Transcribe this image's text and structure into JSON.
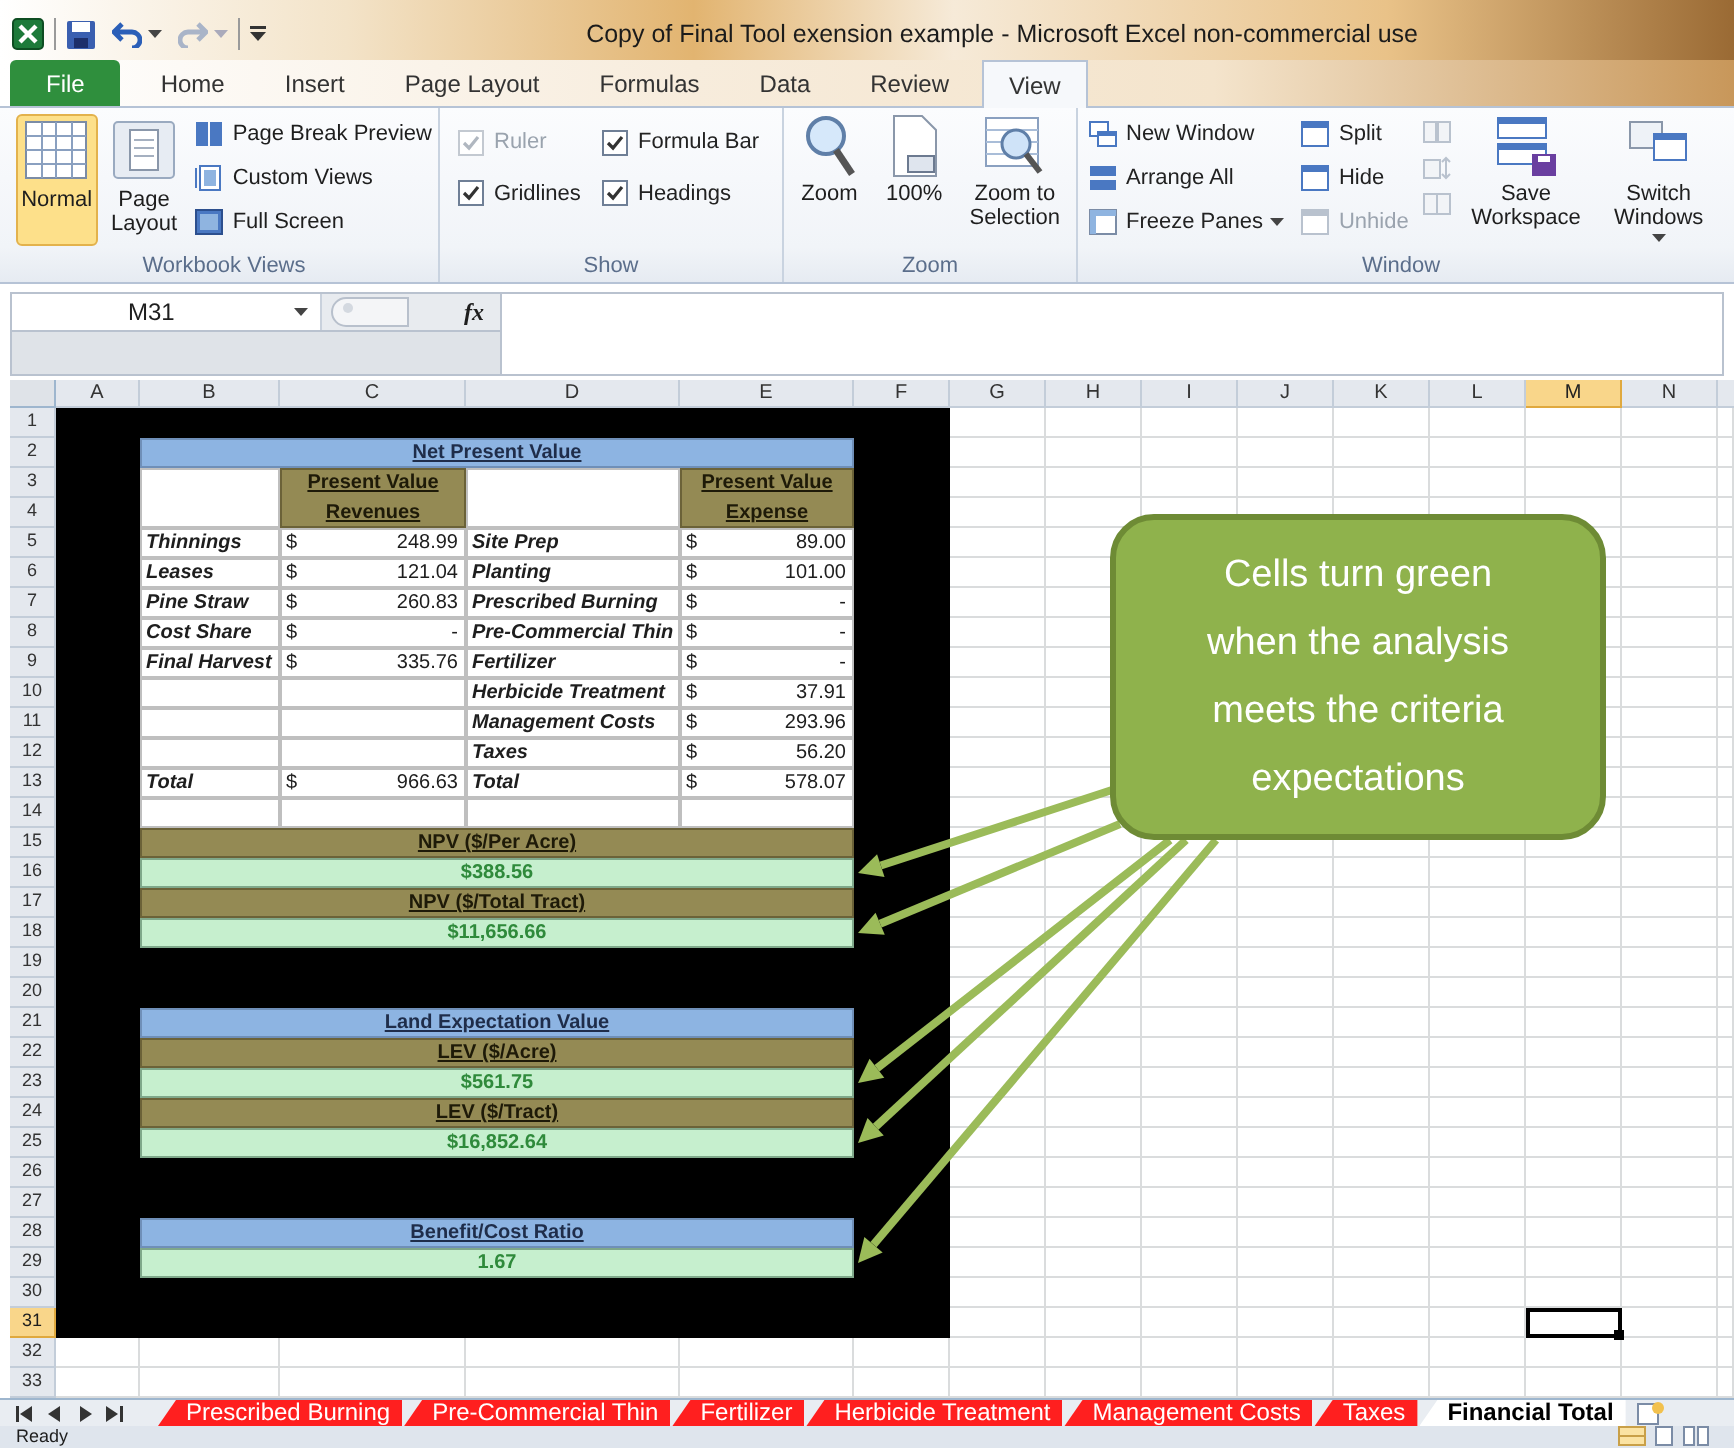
{
  "title_bar": {
    "title": "Copy of Final Tool exension example - Microsoft Excel non-commercial use"
  },
  "ribbon_tabs": [
    {
      "label": "File",
      "kind": "file",
      "selected": false
    },
    {
      "label": "Home",
      "kind": "tab",
      "selected": false
    },
    {
      "label": "Insert",
      "kind": "tab",
      "selected": false
    },
    {
      "label": "Page Layout",
      "kind": "tab",
      "selected": false
    },
    {
      "label": "Formulas",
      "kind": "tab",
      "selected": false
    },
    {
      "label": "Data",
      "kind": "tab",
      "selected": false
    },
    {
      "label": "Review",
      "kind": "tab",
      "selected": false
    },
    {
      "label": "View",
      "kind": "tab",
      "selected": true
    }
  ],
  "ribbon": {
    "workbook_views": {
      "label": "Workbook Views",
      "large_buttons": [
        {
          "label": "Normal",
          "selected": true
        },
        {
          "label": "Page Layout",
          "selected": false
        }
      ],
      "small_buttons": [
        {
          "label": "Page Break Preview"
        },
        {
          "label": "Custom Views"
        },
        {
          "label": "Full Screen"
        }
      ]
    },
    "show": {
      "label": "Show",
      "options": [
        {
          "label": "Ruler",
          "checked": true,
          "disabled": true
        },
        {
          "label": "Formula Bar",
          "checked": true,
          "disabled": false
        },
        {
          "label": "Gridlines",
          "checked": true,
          "disabled": false
        },
        {
          "label": "Headings",
          "checked": true,
          "disabled": false
        }
      ]
    },
    "zoom": {
      "label": "Zoom",
      "buttons": [
        {
          "label": "Zoom"
        },
        {
          "label": "100%"
        },
        {
          "label": "Zoom to Selection"
        }
      ]
    },
    "window": {
      "label": "Window",
      "commands": [
        {
          "label": "New Window",
          "disabled": false,
          "dropdown": false
        },
        {
          "label": "Arrange All",
          "disabled": false,
          "dropdown": false
        },
        {
          "label": "Freeze Panes",
          "disabled": false,
          "dropdown": true
        },
        {
          "label": "Split",
          "disabled": false,
          "dropdown": false
        },
        {
          "label": "Hide",
          "disabled": false,
          "dropdown": false
        },
        {
          "label": "Unhide",
          "disabled": true,
          "dropdown": false
        }
      ],
      "large_buttons": [
        {
          "label": "Save Workspace",
          "dropdown": false
        },
        {
          "label": "Switch Windows",
          "dropdown": true
        }
      ]
    }
  },
  "formula_bar": {
    "name_box": "M31",
    "function_button": "fx"
  },
  "columns": [
    {
      "label": "A",
      "selected": false
    },
    {
      "label": "B",
      "selected": false
    },
    {
      "label": "C",
      "selected": false
    },
    {
      "label": "D",
      "selected": false
    },
    {
      "label": "E",
      "selected": false
    },
    {
      "label": "F",
      "selected": false
    },
    {
      "label": "G",
      "selected": false
    },
    {
      "label": "H",
      "selected": false
    },
    {
      "label": "I",
      "selected": false
    },
    {
      "label": "J",
      "selected": false
    },
    {
      "label": "K",
      "selected": false
    },
    {
      "label": "L",
      "selected": false
    },
    {
      "label": "M",
      "selected": true
    },
    {
      "label": "N",
      "selected": false
    }
  ],
  "rows": [
    {
      "label": "1",
      "selected": false
    },
    {
      "label": "2",
      "selected": false
    },
    {
      "label": "3",
      "selected": false
    },
    {
      "label": "4",
      "selected": false
    },
    {
      "label": "5",
      "selected": false
    },
    {
      "label": "6",
      "selected": false
    },
    {
      "label": "7",
      "selected": false
    },
    {
      "label": "8",
      "selected": false
    },
    {
      "label": "9",
      "selected": false
    },
    {
      "label": "10",
      "selected": false
    },
    {
      "label": "11",
      "selected": false
    },
    {
      "label": "12",
      "selected": false
    },
    {
      "label": "13",
      "selected": false
    },
    {
      "label": "14",
      "selected": false
    },
    {
      "label": "15",
      "selected": false
    },
    {
      "label": "16",
      "selected": false
    },
    {
      "label": "17",
      "selected": false
    },
    {
      "label": "18",
      "selected": false
    },
    {
      "label": "19",
      "selected": false
    },
    {
      "label": "20",
      "selected": false
    },
    {
      "label": "21",
      "selected": false
    },
    {
      "label": "22",
      "selected": false
    },
    {
      "label": "23",
      "selected": false
    },
    {
      "label": "24",
      "selected": false
    },
    {
      "label": "25",
      "selected": false
    },
    {
      "label": "26",
      "selected": false
    },
    {
      "label": "27",
      "selected": false
    },
    {
      "label": "28",
      "selected": false
    },
    {
      "label": "29",
      "selected": false
    },
    {
      "label": "30",
      "selected": false
    },
    {
      "label": "31",
      "selected": true
    },
    {
      "label": "32",
      "selected": false
    },
    {
      "label": "33",
      "selected": false
    }
  ],
  "npv_table": {
    "title": "Net Present Value",
    "revenue_header": "Present Value Revenues",
    "expense_header": "Present Value Expense",
    "rows": [
      {
        "revenue_item": "Thinnings",
        "revenue_currency": "$",
        "revenue_amount": "248.99",
        "expense_item": "Site Prep",
        "expense_currency": "$",
        "expense_amount": "89.00"
      },
      {
        "revenue_item": "Leases",
        "revenue_currency": "$",
        "revenue_amount": "121.04",
        "expense_item": "Planting",
        "expense_currency": "$",
        "expense_amount": "101.00"
      },
      {
        "revenue_item": "Pine Straw",
        "revenue_currency": "$",
        "revenue_amount": "260.83",
        "expense_item": "Prescribed Burning",
        "expense_currency": "$",
        "expense_amount": "-"
      },
      {
        "revenue_item": "Cost Share",
        "revenue_currency": "$",
        "revenue_amount": "-",
        "expense_item": "Pre-Commercial Thin",
        "expense_currency": "$",
        "expense_amount": "-"
      },
      {
        "revenue_item": "Final Harvest",
        "revenue_currency": "$",
        "revenue_amount": "335.76",
        "expense_item": "Fertilizer",
        "expense_currency": "$",
        "expense_amount": "-"
      },
      {
        "expense_item": "Herbicide Treatment",
        "expense_currency": "$",
        "expense_amount": "37.91"
      },
      {
        "expense_item": "Management Costs",
        "expense_currency": "$",
        "expense_amount": "293.96"
      },
      {
        "expense_item": "Taxes",
        "expense_currency": "$",
        "expense_amount": "56.20"
      },
      {
        "revenue_item": "Total",
        "revenue_currency": "$",
        "revenue_amount": "966.63",
        "expense_item": "Total",
        "expense_currency": "$",
        "expense_amount": "578.07"
      }
    ]
  },
  "summary_sections": [
    {
      "metrics": [
        {
          "label": "NPV ($/Per Acre)",
          "value": "$388.56",
          "meets_criteria": true
        },
        {
          "label": "NPV ($/Total Tract)",
          "value": "$11,656.66",
          "meets_criteria": true
        }
      ]
    },
    {
      "title": "Land Expectation Value",
      "metrics": [
        {
          "label": "LEV ($/Acre)",
          "value": "$561.75",
          "meets_criteria": true
        },
        {
          "label": "LEV ($/Tract)",
          "value": "$16,852.64",
          "meets_criteria": true
        }
      ]
    },
    {
      "title": "Benefit/Cost Ratio",
      "metrics": [
        {
          "value": "1.67",
          "meets_criteria": true
        }
      ]
    }
  ],
  "callout": {
    "text": "Cells turn green when the analysis meets the criteria expectations"
  },
  "sheet_tabs": [
    {
      "label": "Prescribed Burning",
      "color": "#ff1f1f",
      "selected": false
    },
    {
      "label": "Pre-Commercial Thin",
      "color": "#ff1f1f",
      "selected": false
    },
    {
      "label": "Fertilizer",
      "color": "#ff1f1f",
      "selected": false
    },
    {
      "label": "Herbicide Treatment",
      "color": "#ff1f1f",
      "selected": false
    },
    {
      "label": "Management Costs",
      "color": "#ff1f1f",
      "selected": false
    },
    {
      "label": "Taxes",
      "color": "#ff1f1f",
      "selected": false
    },
    {
      "label": "Financial Total",
      "color": "#ffffff",
      "selected": true
    }
  ],
  "status_bar": {
    "status": "Ready"
  }
}
